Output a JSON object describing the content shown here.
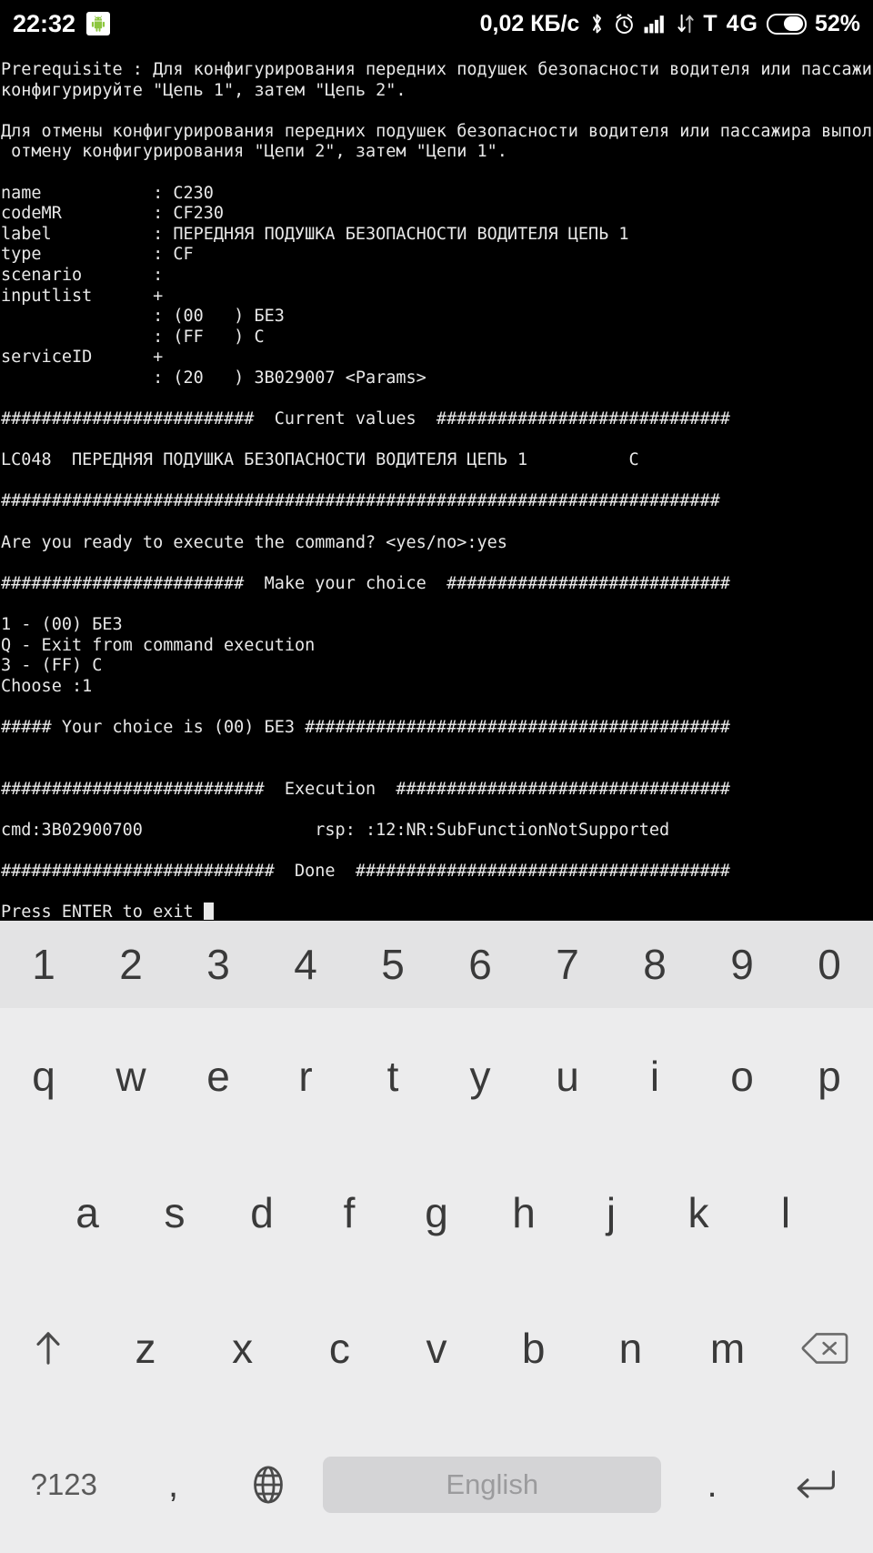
{
  "statusbar": {
    "clock": "22:32",
    "app_icon": "android-robot-icon",
    "network_speed": "0,02 КБ/c",
    "bluetooth_icon": "bluetooth-icon",
    "alarm_icon": "alarm-clock-icon",
    "signal_icon": "signal-bars-icon",
    "data_transfer_icon": "data-transfer-arrows-icon",
    "carrier": "T",
    "network_type": "4G",
    "battery_icon": "battery-icon",
    "battery_percent": "52%"
  },
  "terminal": {
    "lines": [
      "Prerequisite : Для конфигурирования передних подушек безопасности водителя или пассажира с",
      "конфигурируйте \"Цепь 1\", затем \"Цепь 2\".",
      "",
      "Для отмены конфигурирования передних подушек безопасности водителя или пассажира выполните",
      " отмену конфигурирования \"Цепи 2\", затем \"Цепи 1\".",
      "",
      "name           : C230",
      "codeMR         : CF230",
      "label          : ПЕРЕДНЯЯ ПОДУШКА БЕЗОПАСНОСТИ ВОДИТЕЛЯ ЦЕПЬ 1",
      "type           : CF",
      "scenario       :",
      "inputlist      +",
      "               : (00   ) БЕЗ",
      "               : (FF   ) C",
      "serviceID      +",
      "               : (20   ) 3B029007 <Params>",
      "",
      "#########################  Current values  #############################",
      "",
      "LC048  ПЕРЕДНЯЯ ПОДУШКА БЕЗОПАСНОСТИ ВОДИТЕЛЯ ЦЕПЬ 1          C",
      "",
      "#######################################################################",
      "",
      "Are you ready to execute the command? <yes/no>:yes",
      "",
      "########################  Make your choice  ############################",
      "",
      "1 - (00) БЕЗ",
      "Q - Exit from command execution",
      "3 - (FF) C",
      "Choose :1",
      "",
      "##### Your choice is (00) БЕЗ ##########################################",
      "",
      "",
      "##########################  Execution  #################################",
      "",
      "cmd:3B02900700                 rsp: :12:NR:SubFunctionNotSupported",
      "",
      "###########################  Done  #####################################",
      "",
      "Press ENTER to exit "
    ],
    "cursor_visible": true
  },
  "keyboard": {
    "number_row": [
      "1",
      "2",
      "3",
      "4",
      "5",
      "6",
      "7",
      "8",
      "9",
      "0"
    ],
    "row_qwerty": [
      "q",
      "w",
      "e",
      "r",
      "t",
      "y",
      "u",
      "i",
      "o",
      "p"
    ],
    "row_asdf": [
      "a",
      "s",
      "d",
      "f",
      "g",
      "h",
      "j",
      "k",
      "l"
    ],
    "row_zxcv": [
      "z",
      "x",
      "c",
      "v",
      "b",
      "n",
      "m"
    ],
    "shift_icon": "shift-arrow-up-icon",
    "backspace_icon": "backspace-delete-icon",
    "symbols_label": "?123",
    "comma_label": ",",
    "globe_icon": "globe-language-icon",
    "space_label": "English",
    "period_label": ".",
    "enter_icon": "enter-return-arrow-icon"
  },
  "colors": {
    "terminal_bg": "#000000",
    "terminal_fg": "#e8e8e8",
    "keyboard_bg": "#ececed",
    "keyboard_numrow_bg": "#e3e3e4",
    "key_text": "#3a3a3a",
    "space_key_bg": "#d4d4d6",
    "space_key_text": "#9b9b9d"
  }
}
